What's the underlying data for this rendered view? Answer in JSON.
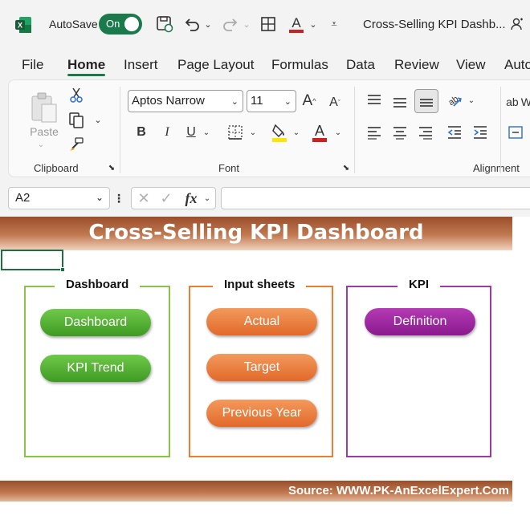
{
  "titlebar": {
    "autosave_label": "AutoSave",
    "toggle_state": "On",
    "doc_title": "Cross-Selling KPI Dashb..."
  },
  "menu": {
    "tabs": [
      "File",
      "Home",
      "Insert",
      "Page Layout",
      "Formulas",
      "Data",
      "Review",
      "View",
      "Auto"
    ],
    "active": "Home"
  },
  "ribbon": {
    "clipboard": {
      "paste_label": "Paste",
      "group_label": "Clipboard"
    },
    "font": {
      "font_name": "Aptos Narrow",
      "font_size": "11",
      "group_label": "Font",
      "font_color": "#d11f1f",
      "fill_color": "#ffe500"
    },
    "alignment": {
      "group_label": "Alignment"
    },
    "cut_off_label": "W"
  },
  "formula_bar": {
    "name_box": "A2",
    "fx_label": "fx",
    "formula": ""
  },
  "sheet": {
    "title": "Cross-Selling KPI Dashboard",
    "source": "Source: WWW.PK-AnExcelExpert.Com",
    "panels": [
      {
        "title": "Dashboard",
        "color": "#8bc34a",
        "buttons": [
          "Dashboard",
          "KPI Trend"
        ]
      },
      {
        "title": "Input sheets",
        "color": "#ed7d31",
        "buttons": [
          "Actual",
          "Target",
          "Previous Year"
        ]
      },
      {
        "title": "KPI",
        "color": "#a03aa0",
        "buttons": [
          "Definition"
        ]
      }
    ]
  }
}
